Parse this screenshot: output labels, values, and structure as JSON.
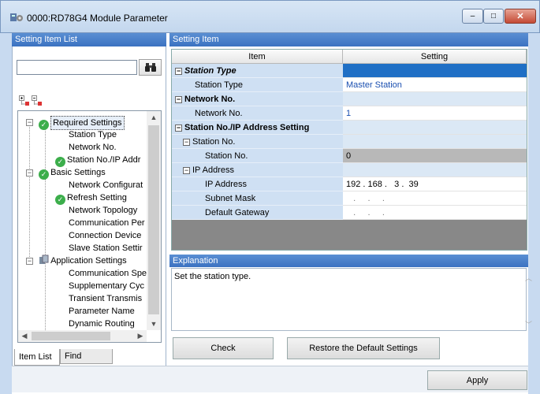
{
  "window": {
    "title": "0000:RD78G4 Module Parameter",
    "minimize_glyph": "–",
    "maximize_glyph": "□",
    "close_glyph": "✕"
  },
  "left_panel": {
    "header": "Setting Item List",
    "search_value": "",
    "tree": [
      {
        "label": "Required Settings",
        "level": 0,
        "icon": "check-icon",
        "expander": "-",
        "selected": true
      },
      {
        "label": "Station Type",
        "level": 1
      },
      {
        "label": "Network No.",
        "level": 1
      },
      {
        "label": "Station No./IP Addr",
        "level": 1,
        "icon": "check-icon"
      },
      {
        "label": "Basic Settings",
        "level": 0,
        "icon": "check-icon",
        "expander": "-"
      },
      {
        "label": "Network Configurat",
        "level": 1
      },
      {
        "label": "Refresh Setting",
        "level": 1,
        "icon": "check-icon"
      },
      {
        "label": "Network Topology",
        "level": 1
      },
      {
        "label": "Communication Per",
        "level": 1
      },
      {
        "label": "Connection Device",
        "level": 1
      },
      {
        "label": "Slave Station Settir",
        "level": 1
      },
      {
        "label": "Application Settings",
        "level": 0,
        "icon": "app-settings-icon",
        "expander": "-"
      },
      {
        "label": "Communication Spe",
        "level": 1
      },
      {
        "label": "Supplementary Cyc",
        "level": 1
      },
      {
        "label": "Transient Transmis",
        "level": 1
      },
      {
        "label": "Parameter Name",
        "level": 1
      },
      {
        "label": "Dynamic Routing",
        "level": 1
      }
    ],
    "tabs": [
      "Item List",
      "Find Result"
    ]
  },
  "right_panel": {
    "header": "Setting Item",
    "columns": [
      "Item",
      "Setting"
    ],
    "rows": [
      {
        "item": "Station Type",
        "setting": "",
        "level": 0,
        "style": "bold-italic",
        "state": "selected",
        "expander": true
      },
      {
        "item": "Station Type",
        "setting": "Master Station",
        "level": 1,
        "state": "value"
      },
      {
        "item": "Network No.",
        "setting": "",
        "level": 0,
        "style": "bold",
        "state": "blank",
        "expander": true
      },
      {
        "item": "Network No.",
        "setting": "1",
        "level": 1,
        "state": "value"
      },
      {
        "item": "Station No./IP Address Setting",
        "setting": "",
        "level": 0,
        "style": "bold",
        "state": "blank",
        "expander": true
      },
      {
        "item": "Station No.",
        "setting": "",
        "level": 1,
        "state": "blank",
        "expander": true
      },
      {
        "item": "Station No.",
        "setting": "0",
        "level": 2,
        "state": "grey"
      },
      {
        "item": "IP Address",
        "setting": "",
        "level": 1,
        "state": "blank",
        "expander": true
      },
      {
        "item": "IP Address",
        "setting": "192 . 168 .   3 .  39",
        "level": 2,
        "state": "plain"
      },
      {
        "item": "Subnet Mask",
        "setting": "   .     .     .",
        "level": 2,
        "state": "plain"
      },
      {
        "item": "Default Gateway",
        "setting": "   .     .     .",
        "level": 2,
        "state": "plain"
      }
    ]
  },
  "explanation": {
    "header": "Explanation",
    "text": "Set the station type."
  },
  "buttons": {
    "check": "Check",
    "restore": "Restore the Default Settings",
    "apply": "Apply"
  }
}
